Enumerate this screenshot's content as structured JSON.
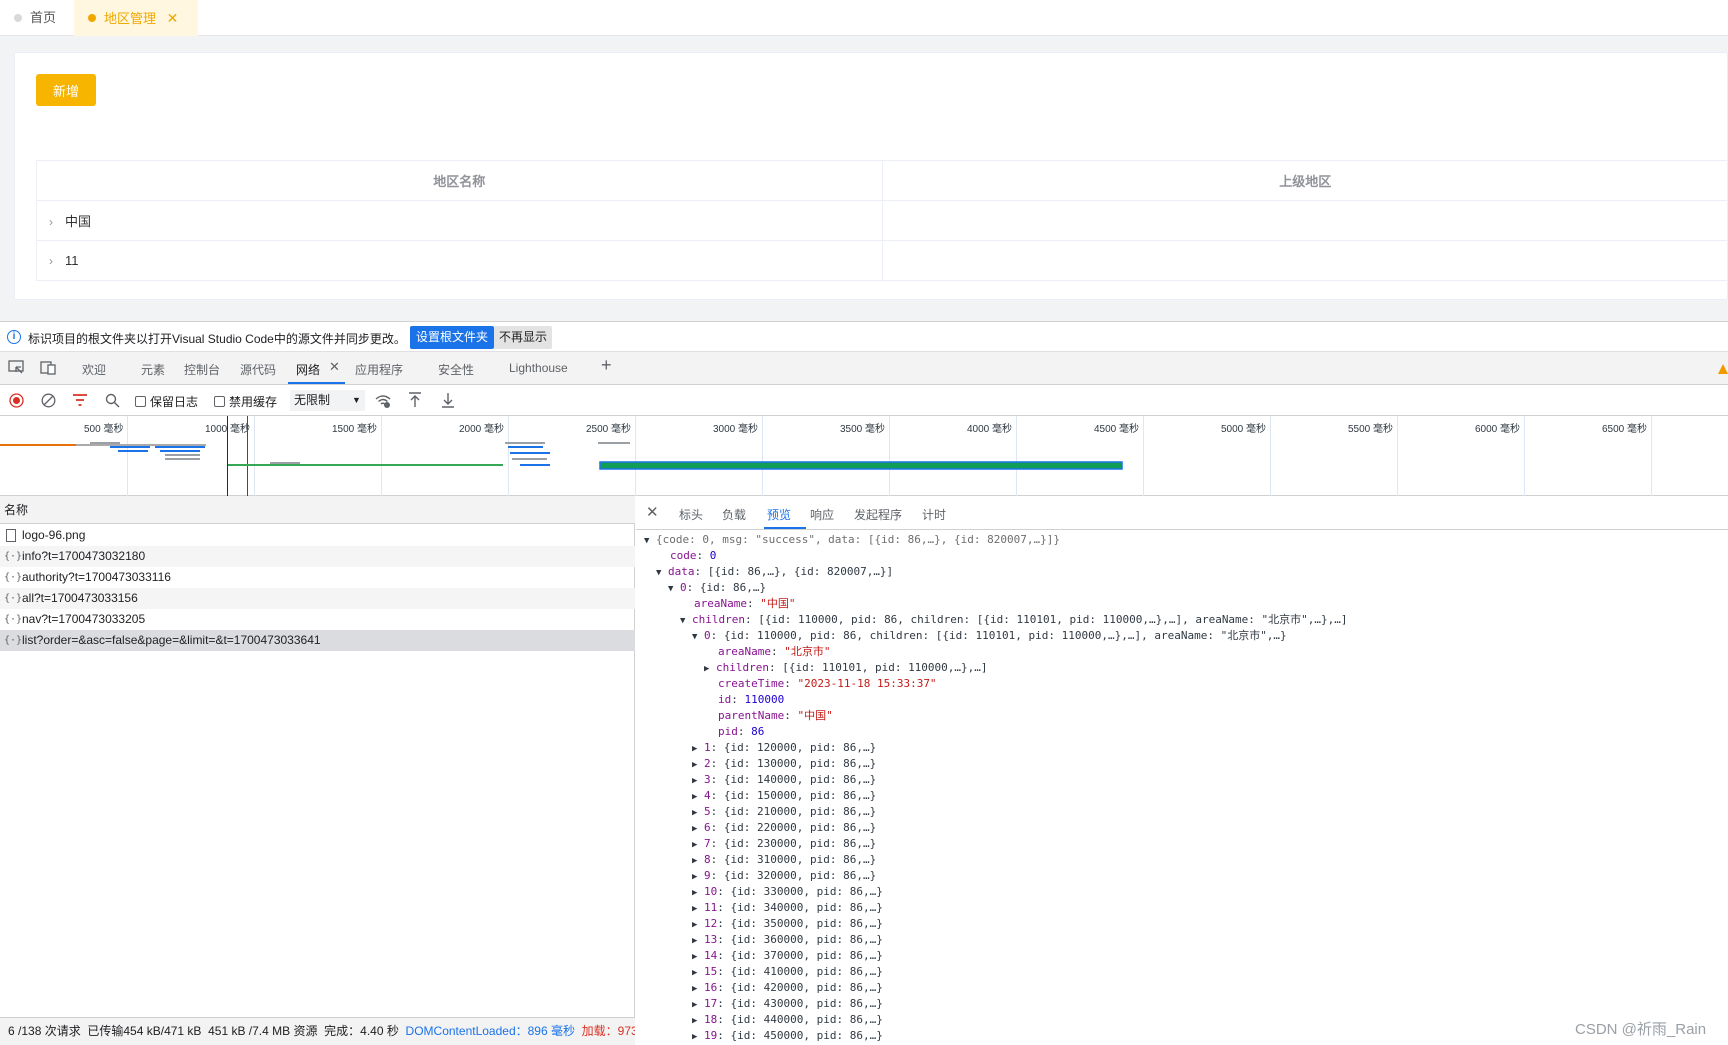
{
  "app": {
    "tabs": [
      {
        "label": "首页",
        "active": false
      },
      {
        "label": "地区管理",
        "active": true
      }
    ],
    "add_button": "新增",
    "table": {
      "columns": [
        "地区名称",
        "上级地区"
      ],
      "rows": [
        {
          "name": "中国",
          "parent": ""
        },
        {
          "name": "11",
          "parent": ""
        }
      ]
    },
    "colors": {
      "accent": "#f7b500",
      "page_bg": "#f2f3f5"
    }
  },
  "devtools": {
    "infobar": {
      "message": "标识项目的根文件夹以打开Visual Studio Code中的源文件并同步更改。",
      "primary_button": "设置根文件夹",
      "secondary_button": "不再显示"
    },
    "tabs": [
      "欢迎",
      "元素",
      "控制台",
      "源代码",
      "网络",
      "应用程序",
      "安全性",
      "Lighthouse"
    ],
    "active_tab": "网络",
    "toolbar": {
      "preserve_log": "保留日志",
      "disable_cache": "禁用缓存",
      "throttle": "无限制"
    },
    "overview_ticks": [
      "500 毫秒",
      "1000 毫秒",
      "1500 毫秒",
      "2000 毫秒",
      "2500 毫秒",
      "3000 毫秒",
      "3500 毫秒",
      "4000 毫秒",
      "4500 毫秒",
      "5000 毫秒",
      "5500 毫秒",
      "6000 毫秒",
      "6500 毫秒"
    ],
    "requests": {
      "header": "名称",
      "items": [
        "logo-96.png",
        "info?t=1700473032180",
        "authority?t=1700473033116",
        "all?t=1700473033156",
        "nav?t=1700473033205",
        "list?order=&asc=false&page=&limit=&t=1700473033641"
      ],
      "selected_index": 5
    },
    "status_bar": {
      "requests": "6 /138 次请求",
      "transferred": "已传输454 kB/471 kB",
      "resources": "451 kB /7.4 MB 资源",
      "finish": "完成：4.40 秒",
      "dom_content_loaded": "DOMContentLoaded：896 毫秒",
      "load": "加载：973"
    },
    "detail_tabs": [
      "标头",
      "负载",
      "预览",
      "响应",
      "发起程序",
      "计时"
    ],
    "detail_active": "预览",
    "preview": {
      "root_summary": "{code: 0, msg: \"success\", data: [{id: 86,…}, {id: 820007,…}]}",
      "code_key": "code",
      "code_value": "0",
      "data_key": "data",
      "data_summary": "[{id: 86,…}, {id: 820007,…}]",
      "item0_key": "0",
      "item0_summary": "{id: 86,…}",
      "areaName_key": "areaName",
      "areaName_value": "\"中国\"",
      "children_key": "children",
      "children_summary": "[{id: 110000, pid: 86, children: [{id: 110101, pid: 110000,…},…], areaName: \"北京市\",…},…]",
      "child0_key": "0",
      "child0_summary": "{id: 110000, pid: 86, children: [{id: 110101, pid: 110000,…},…], areaName: \"北京市\",…}",
      "child0_areaName_key": "areaName",
      "child0_areaName_value": "\"北京市\"",
      "child0_children_key": "children",
      "child0_children_summary": "[{id: 110101, pid: 110000,…},…]",
      "createTime_key": "createTime",
      "createTime_value": "\"2023-11-18 15:33:37\"",
      "id_key": "id",
      "id_value": "110000",
      "parentName_key": "parentName",
      "parentName_value": "\"中国\"",
      "pid_key": "pid",
      "pid_value": "86",
      "collapsed_children": [
        {
          "key": "1",
          "summary": "{id: 120000, pid: 86,…}"
        },
        {
          "key": "2",
          "summary": "{id: 130000, pid: 86,…}"
        },
        {
          "key": "3",
          "summary": "{id: 140000, pid: 86,…}"
        },
        {
          "key": "4",
          "summary": "{id: 150000, pid: 86,…}"
        },
        {
          "key": "5",
          "summary": "{id: 210000, pid: 86,…}"
        },
        {
          "key": "6",
          "summary": "{id: 220000, pid: 86,…}"
        },
        {
          "key": "7",
          "summary": "{id: 230000, pid: 86,…}"
        },
        {
          "key": "8",
          "summary": "{id: 310000, pid: 86,…}"
        },
        {
          "key": "9",
          "summary": "{id: 320000, pid: 86,…}"
        },
        {
          "key": "10",
          "summary": "{id: 330000, pid: 86,…}"
        },
        {
          "key": "11",
          "summary": "{id: 340000, pid: 86,…}"
        },
        {
          "key": "12",
          "summary": "{id: 350000, pid: 86,…}"
        },
        {
          "key": "13",
          "summary": "{id: 360000, pid: 86,…}"
        },
        {
          "key": "14",
          "summary": "{id: 370000, pid: 86,…}"
        },
        {
          "key": "15",
          "summary": "{id: 410000, pid: 86,…}"
        },
        {
          "key": "16",
          "summary": "{id: 420000, pid: 86,…}"
        },
        {
          "key": "17",
          "summary": "{id: 430000, pid: 86,…}"
        },
        {
          "key": "18",
          "summary": "{id: 440000, pid: 86,…}"
        },
        {
          "key": "19",
          "summary": "{id: 450000, pid: 86,…}"
        }
      ]
    }
  },
  "watermark": "CSDN @祈雨_Rain"
}
